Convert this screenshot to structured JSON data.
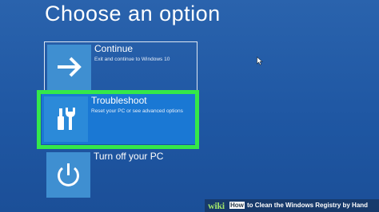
{
  "screen": {
    "title": "Choose an option"
  },
  "options": [
    {
      "label": "Continue",
      "description": "Exit and continue to Windows 10",
      "icon": "arrow-right-icon"
    },
    {
      "label": "Troubleshoot",
      "description": "Reset your PC or see advanced options",
      "icon": "tools-icon",
      "highlight": "#34e84a"
    },
    {
      "label": "Turn off your PC",
      "description": "",
      "icon": "power-icon"
    }
  ],
  "watermark": {
    "brand": "wiki",
    "how": "How",
    "text": "to Clean the Windows Registry by Hand"
  },
  "colors": {
    "background": "#1f57a3",
    "selected_tile": "#1a78d4",
    "highlight": "#34e84a"
  }
}
